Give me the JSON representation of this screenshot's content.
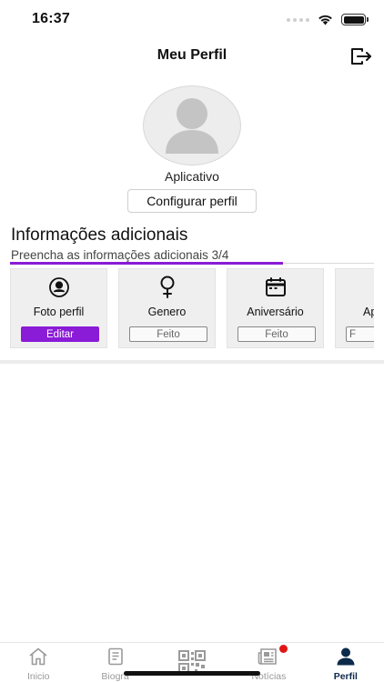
{
  "status_bar": {
    "time": "16:37"
  },
  "header": {
    "title": "Meu Perfil",
    "logout_icon": "logout-icon"
  },
  "profile": {
    "name": "Aplicativo",
    "configure_button": "Configurar perfil",
    "avatar_icon": "user-placeholder-icon"
  },
  "additional_info": {
    "title": "Informações adicionais",
    "subtitle": "Preencha as informações adicionais 3/4",
    "progress": 0.75,
    "accent_color": "#8a1bd6",
    "cards": [
      {
        "label": "Foto perfil",
        "button": "Editar",
        "icon": "profile-photo-icon",
        "state": "pending"
      },
      {
        "label": "Genero",
        "button": "Feito",
        "icon": "female-gender-icon",
        "state": "done"
      },
      {
        "label": "Aniversário",
        "button": "Feito",
        "icon": "calendar-icon",
        "state": "done"
      },
      {
        "label": "Ap",
        "button": "F",
        "icon": "unknown-icon",
        "state": "done"
      }
    ]
  },
  "tab_bar": {
    "tabs": [
      {
        "label": "Inicio",
        "icon": "home-icon",
        "active": false
      },
      {
        "label": "Biográ",
        "icon": "document-icon",
        "active": false
      },
      {
        "label": "",
        "icon": "qr-code-icon",
        "active": false
      },
      {
        "label": "Notícias",
        "icon": "newspaper-icon",
        "active": false,
        "badge": true
      },
      {
        "label": "Perfil",
        "icon": "person-icon",
        "active": true
      }
    ],
    "active_color": "#0d2a4a",
    "badge_color": "#e01515"
  }
}
